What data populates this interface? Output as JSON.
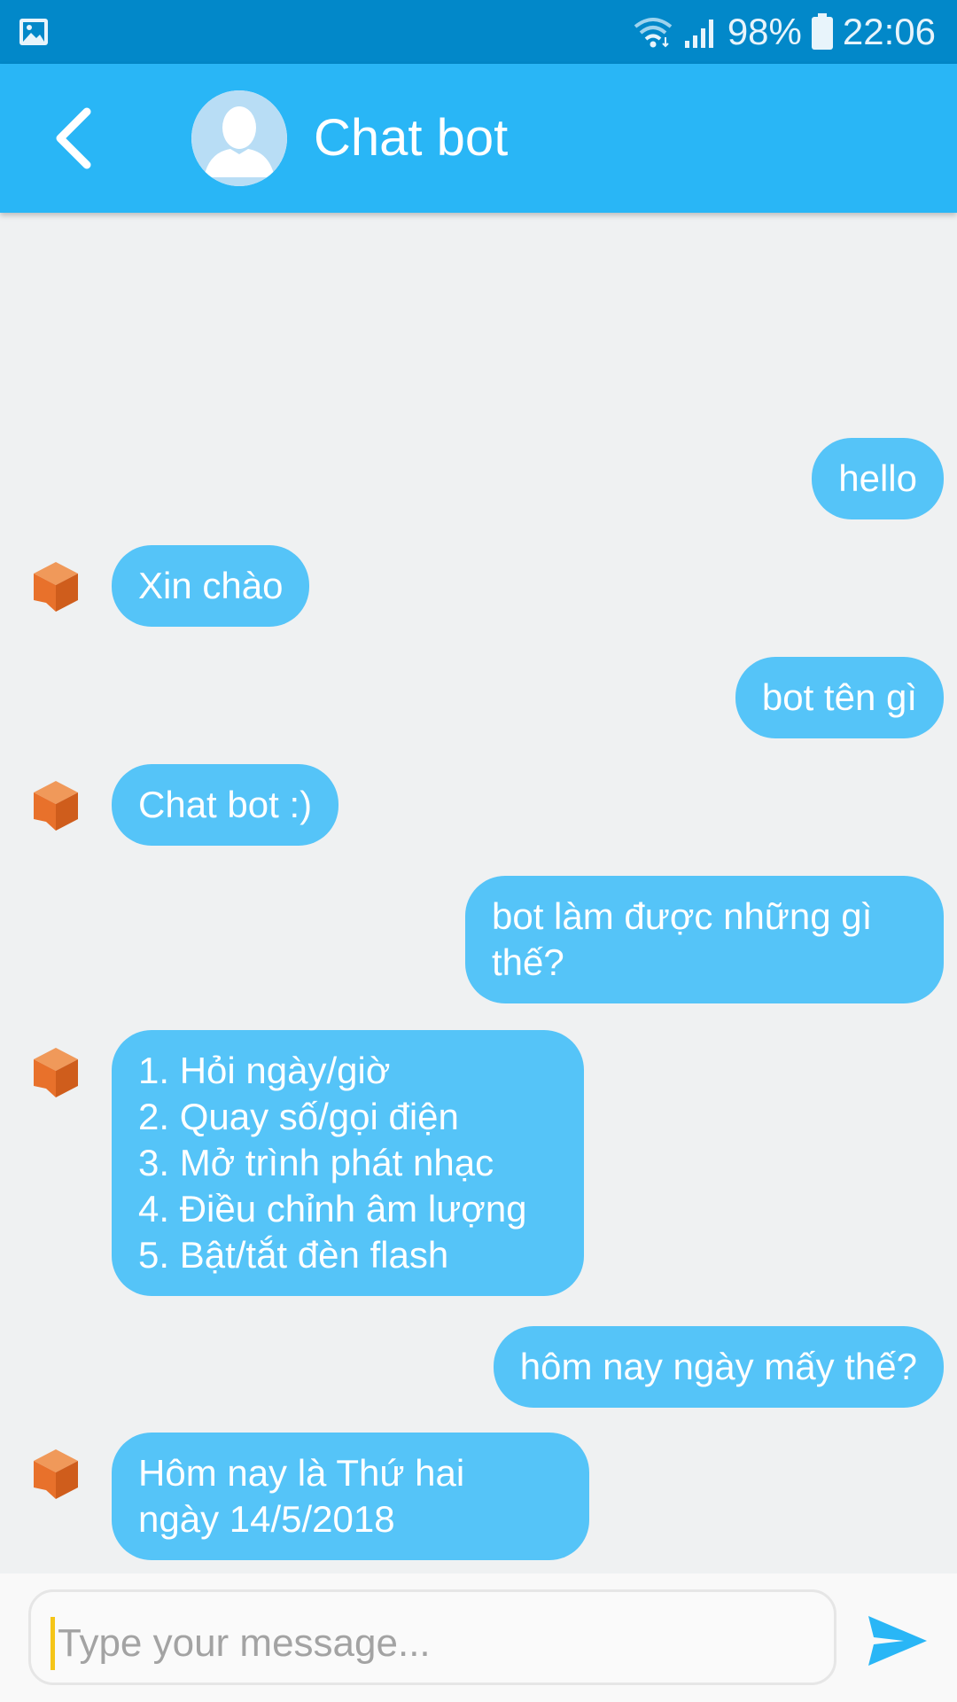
{
  "status_bar": {
    "battery": "98%",
    "time": "22:06",
    "icons": [
      "gallery-notification-icon",
      "wifi-icon",
      "signal-icon",
      "battery-icon"
    ]
  },
  "header": {
    "title": "Chat bot",
    "back_icon": "chevron-left-icon",
    "avatar_icon": "person-avatar-icon"
  },
  "messages": [
    {
      "from": "user",
      "text": "hello"
    },
    {
      "from": "bot",
      "text": "Xin chào"
    },
    {
      "from": "user",
      "text": "bot tên gì"
    },
    {
      "from": "bot",
      "text": "Chat bot :)"
    },
    {
      "from": "user",
      "text": "bot làm được những gì\nthế?"
    },
    {
      "from": "bot",
      "text": "1. Hỏi ngày/giờ\n2. Quay số/gọi điện\n3. Mở trình phát nhạc\n4. Điều chỉnh âm lượng\n5. Bật/tắt đèn flash"
    },
    {
      "from": "user",
      "text": "hôm nay ngày mấy thế?"
    },
    {
      "from": "bot",
      "text": "Hôm nay là Thứ hai\nngày 14/5/2018"
    }
  ],
  "composer": {
    "placeholder": "Type your message...",
    "send_icon": "send-icon"
  },
  "colors": {
    "status_bar": "#0288c9",
    "app_bar": "#29b6f6",
    "bubble": "#55c4f8",
    "bot_icon": "#e8712b",
    "send": "#29b6f6",
    "background": "#eff1f2"
  }
}
